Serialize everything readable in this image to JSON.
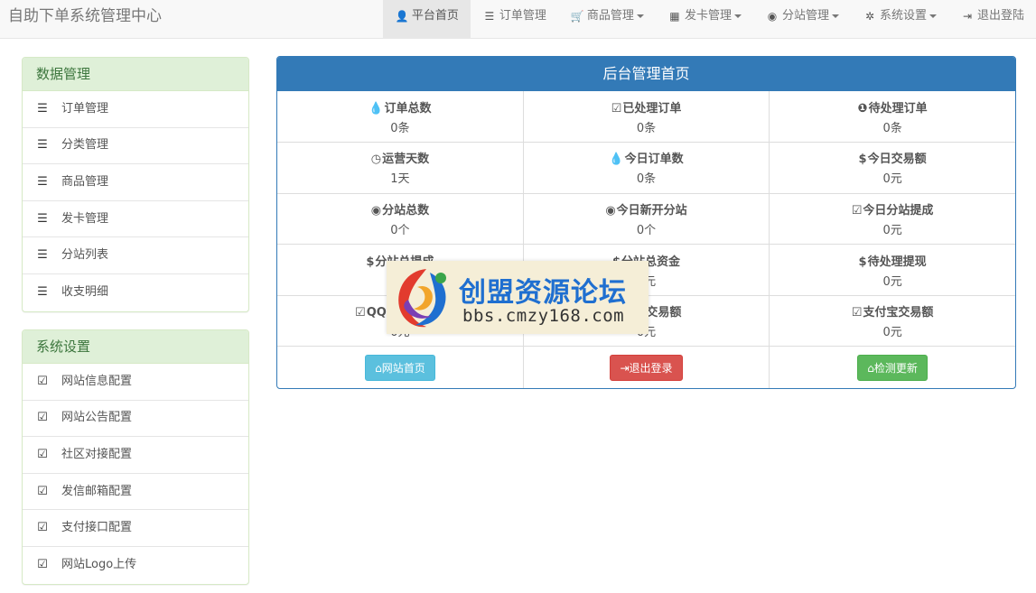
{
  "brand": "自助下单系统管理中心",
  "nav": [
    {
      "icon": "user-icon",
      "glyph": "👤",
      "label": "平台首页",
      "active": true,
      "dropdown": false
    },
    {
      "icon": "list-icon",
      "glyph": "☰",
      "label": "订单管理",
      "active": false,
      "dropdown": false
    },
    {
      "icon": "cart-icon",
      "glyph": "🛒",
      "label": "商品管理",
      "active": false,
      "dropdown": true
    },
    {
      "icon": "grid-icon",
      "glyph": "▦",
      "label": "发卡管理",
      "active": false,
      "dropdown": true
    },
    {
      "icon": "globe-icon",
      "glyph": "◉",
      "label": "分站管理",
      "active": false,
      "dropdown": true
    },
    {
      "icon": "gear-icon",
      "glyph": "✲",
      "label": "系统设置",
      "active": false,
      "dropdown": true
    },
    {
      "icon": "logout-icon",
      "glyph": "⇥",
      "label": "退出登陆",
      "active": false,
      "dropdown": false
    }
  ],
  "sidebar": {
    "data_panel": {
      "title": "数据管理",
      "items": [
        "订单管理",
        "分类管理",
        "商品管理",
        "发卡管理",
        "分站列表",
        "收支明细"
      ]
    },
    "settings_panel": {
      "title": "系统设置",
      "items": [
        "网站信息配置",
        "网站公告配置",
        "社区对接配置",
        "发信邮箱配置",
        "支付接口配置",
        "网站Logo上传"
      ]
    }
  },
  "main": {
    "title": "后台管理首页",
    "stats": [
      [
        {
          "icon": "drop-icon",
          "glyph": "💧",
          "label": "订单总数",
          "value": "0条"
        },
        {
          "icon": "check-icon",
          "glyph": "☑",
          "label": "已处理订单",
          "value": "0条"
        },
        {
          "icon": "info-icon",
          "glyph": "❶",
          "label": "待处理订单",
          "value": "0条"
        }
      ],
      [
        {
          "icon": "clock-icon",
          "glyph": "◷",
          "label": "运营天数",
          "value": "1天"
        },
        {
          "icon": "drop-icon",
          "glyph": "💧",
          "label": "今日订单数",
          "value": "0条"
        },
        {
          "icon": "dollar-icon",
          "glyph": "$",
          "label": "今日交易额",
          "value": "0元"
        }
      ],
      [
        {
          "icon": "globe-icon",
          "glyph": "◉",
          "label": "分站总数",
          "value": "0个"
        },
        {
          "icon": "globe-icon",
          "glyph": "◉",
          "label": "今日新开分站",
          "value": "0个"
        },
        {
          "icon": "check-icon",
          "glyph": "☑",
          "label": "今日分站提成",
          "value": "0元"
        }
      ],
      [
        {
          "icon": "dollar-icon",
          "glyph": "$",
          "label": "分站总提成",
          "value": "0元"
        },
        {
          "icon": "dollar-icon",
          "glyph": "$",
          "label": "分站总资金",
          "value": "0元"
        },
        {
          "icon": "dollar-icon",
          "glyph": "$",
          "label": "待处理提现",
          "value": "0元"
        }
      ],
      [
        {
          "icon": "check-icon",
          "glyph": "☑",
          "label": "QQ钱包交易额",
          "value": "0元"
        },
        {
          "icon": "check-icon",
          "glyph": "☑",
          "label": "微信交易额",
          "value": "0元"
        },
        {
          "icon": "check-icon",
          "glyph": "☑",
          "label": "支付宝交易额",
          "value": "0元"
        }
      ]
    ],
    "buttons": [
      {
        "icon": "home-icon",
        "glyph": "⌂",
        "label": "网站首页",
        "style": "info"
      },
      {
        "icon": "logout-icon",
        "glyph": "⇥",
        "label": "退出登录",
        "style": "danger"
      },
      {
        "icon": "home-icon",
        "glyph": "⌂",
        "label": "检测更新",
        "style": "success"
      }
    ]
  },
  "watermark": {
    "title": "创盟资源论坛",
    "url": "bbs.cmzy168.com"
  },
  "colors": {
    "primary": "#337ab7",
    "success_bg": "#dff0d8",
    "success_text": "#3c763d",
    "info": "#5bc0de",
    "danger": "#d9534f",
    "success": "#5cb85c"
  }
}
